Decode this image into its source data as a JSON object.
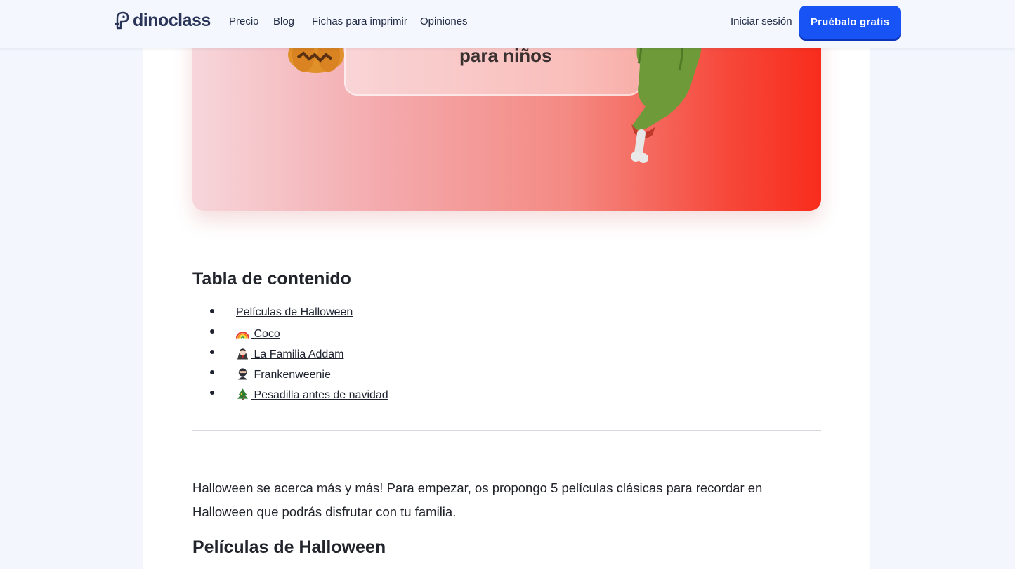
{
  "header": {
    "logo_text": "dinoclass",
    "nav": [
      "Precio",
      "Blog",
      "Fichas para imprimir",
      "Opiniones"
    ],
    "login": "Iniciar sesión",
    "cta": "Pruébalo gratis"
  },
  "hero": {
    "title": "para niños"
  },
  "toc": {
    "title": "Tabla de contenido",
    "items": [
      {
        "label": "Películas de Halloween",
        "icon": ""
      },
      {
        "label": " Coco",
        "icon": "rainbow-icon"
      },
      {
        "label": " La Familia Addam",
        "icon": "vampire-icon"
      },
      {
        "label": " Frankenweenie",
        "icon": "ninja-icon"
      },
      {
        "label": " Pesadilla antes de navidad",
        "icon": "christmas-tree-icon"
      }
    ]
  },
  "article": {
    "intro": "Halloween se acerca más y más! Para empezar, os propongo 5 películas clásicas para recordar en Halloween que podrás disfrutar con tu familia.",
    "section_heading": "Películas de Halloween"
  }
}
